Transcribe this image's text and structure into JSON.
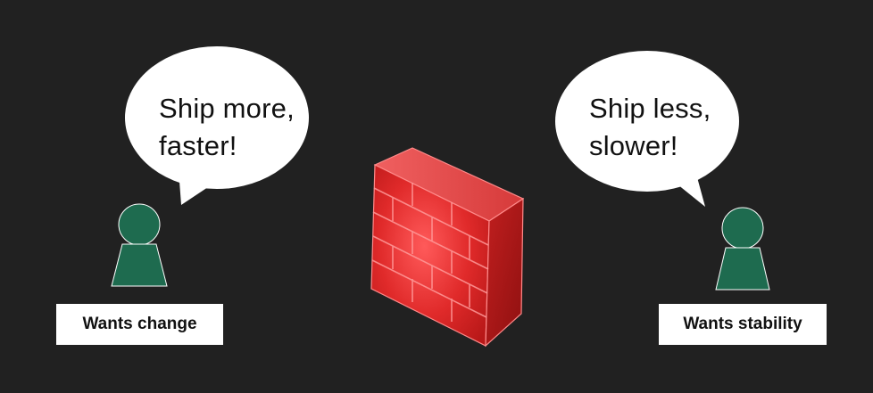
{
  "left_person": {
    "speech_lines": [
      "Ship more,",
      "faster!"
    ],
    "label": "Wants change"
  },
  "right_person": {
    "speech_lines": [
      "Ship less,",
      "slower!"
    ],
    "label": "Wants stability"
  },
  "colors": {
    "background": "#212121",
    "person": "#1e6b4f",
    "bubble": "#ffffff",
    "firewall": "#d62828"
  },
  "icons": {
    "left_person": "person-icon",
    "right_person": "person-icon",
    "center": "firewall-brick-wall-icon"
  }
}
